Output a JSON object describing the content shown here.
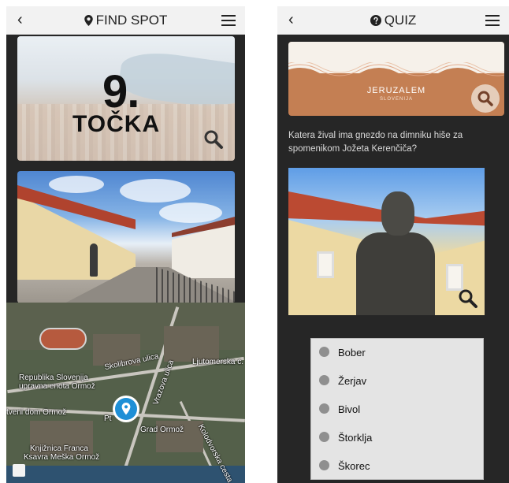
{
  "left_screen": {
    "header": {
      "back_icon": "chevron-left-icon",
      "title_icon": "map-pin-icon",
      "title": "FIND SPOT",
      "menu_icon": "hamburger-menu-icon"
    },
    "aerial_card": {
      "number": "9.",
      "word": "TOČKA",
      "zoom_icon": "magnifier-icon"
    },
    "street_card": {
      "image": "town-square-with-statue"
    },
    "map": {
      "labels": [
        "Skolibrova ulica",
        "Vrazova ulica",
        "Ljutomerska c.",
        "Republika Slovenija",
        "upravna enota Ormož",
        "tveni dom Ormož",
        "Pt",
        "Grad Ormož",
        "Kolodvorska cesta",
        "Knjižnica Franca",
        "Ksavra Meška Ormož"
      ],
      "marker_icon": "location-pin-icon"
    }
  },
  "right_screen": {
    "header": {
      "back_icon": "chevron-left-icon",
      "title_icon": "question-circle-icon",
      "title": "QUIZ",
      "menu_icon": "hamburger-menu-icon"
    },
    "banner": {
      "brand": "JERUZALEM",
      "subtitle": "SLOVENIJA",
      "zoom_icon": "magnifier-icon"
    },
    "question": "Katera žival ima gnezdo na dimniku hiše za spomenikom Jožeta Kerenčiča?",
    "photo": {
      "image": "bust-statue-in-front-of-house",
      "zoom_icon": "magnifier-icon"
    },
    "answers": [
      "Bober",
      "Žerjav",
      "Bivol",
      "Štorklja",
      "Škorec"
    ]
  }
}
